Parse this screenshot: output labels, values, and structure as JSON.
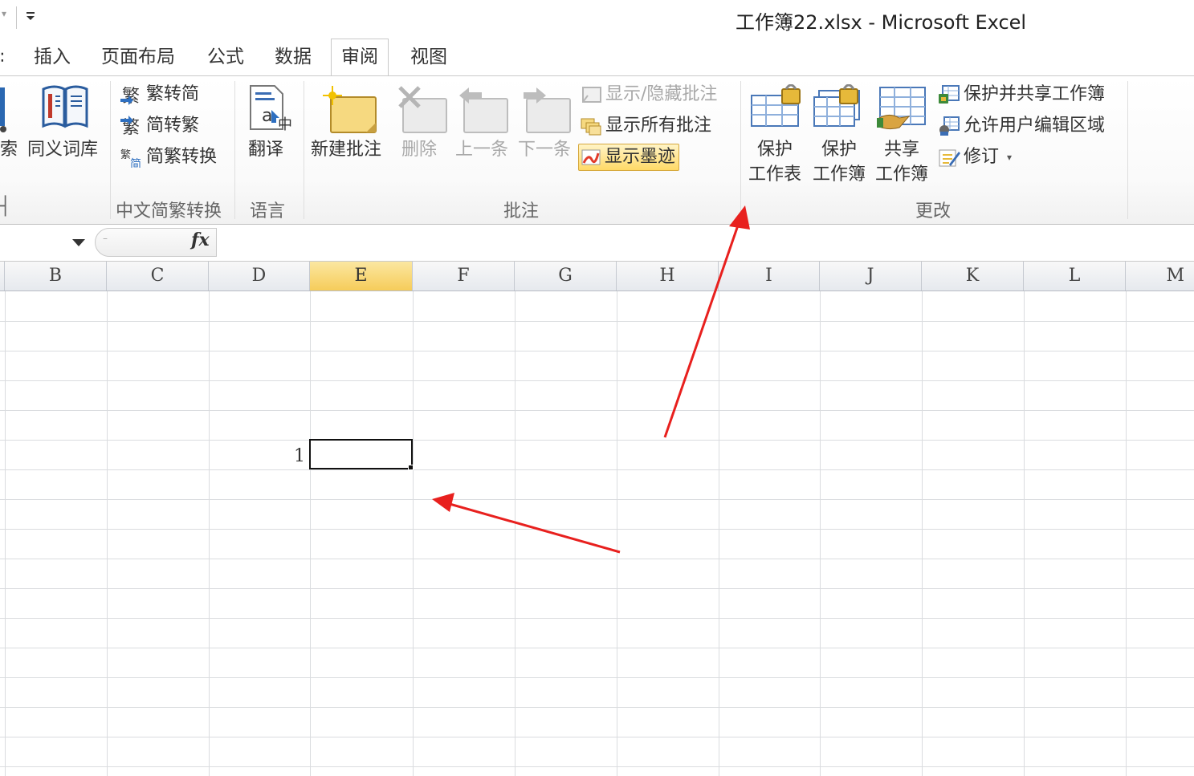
{
  "window": {
    "title": "工作簿22.xlsx - Microsoft Excel"
  },
  "tabs": [
    {
      "label": "插入"
    },
    {
      "label": "页面布局"
    },
    {
      "label": "公式"
    },
    {
      "label": "数据"
    },
    {
      "label": "审阅",
      "active": true
    },
    {
      "label": "视图"
    }
  ],
  "ribbon": {
    "proofing": {
      "research_label": "索",
      "thesaurus_label": "同义词库"
    },
    "chinese_conversion": {
      "group_label": "中文简繁转换",
      "to_simplified": "繁转简",
      "to_traditional": "简转繁",
      "convert": "简繁转换"
    },
    "language": {
      "group_label": "语言",
      "translate": "翻译"
    },
    "comments": {
      "group_label": "批注",
      "new_comment": "新建批注",
      "delete": "删除",
      "previous": "上一条",
      "next": "下一条",
      "show_hide": "显示/隐藏批注",
      "show_all": "显示所有批注",
      "show_ink": "显示墨迹"
    },
    "changes": {
      "group_label": "更改",
      "protect_sheet_1": "保护",
      "protect_sheet_2": "工作表",
      "protect_workbook_1": "保护",
      "protect_workbook_2": "工作簿",
      "share_workbook_1": "共享",
      "share_workbook_2": "工作簿",
      "protect_and_share": "保护并共享工作簿",
      "allow_edit_ranges": "允许用户编辑区域",
      "track_changes": "修订"
    }
  },
  "formula_bar": {
    "fx": "fx"
  },
  "grid": {
    "columns": [
      "B",
      "C",
      "D",
      "E",
      "F",
      "G",
      "H",
      "I",
      "J",
      "K",
      "L",
      "M"
    ],
    "selected_column": "E",
    "row_label": "1"
  },
  "colors": {
    "accent_selected": "#f6cc5a",
    "arrow": "#e8201e"
  }
}
